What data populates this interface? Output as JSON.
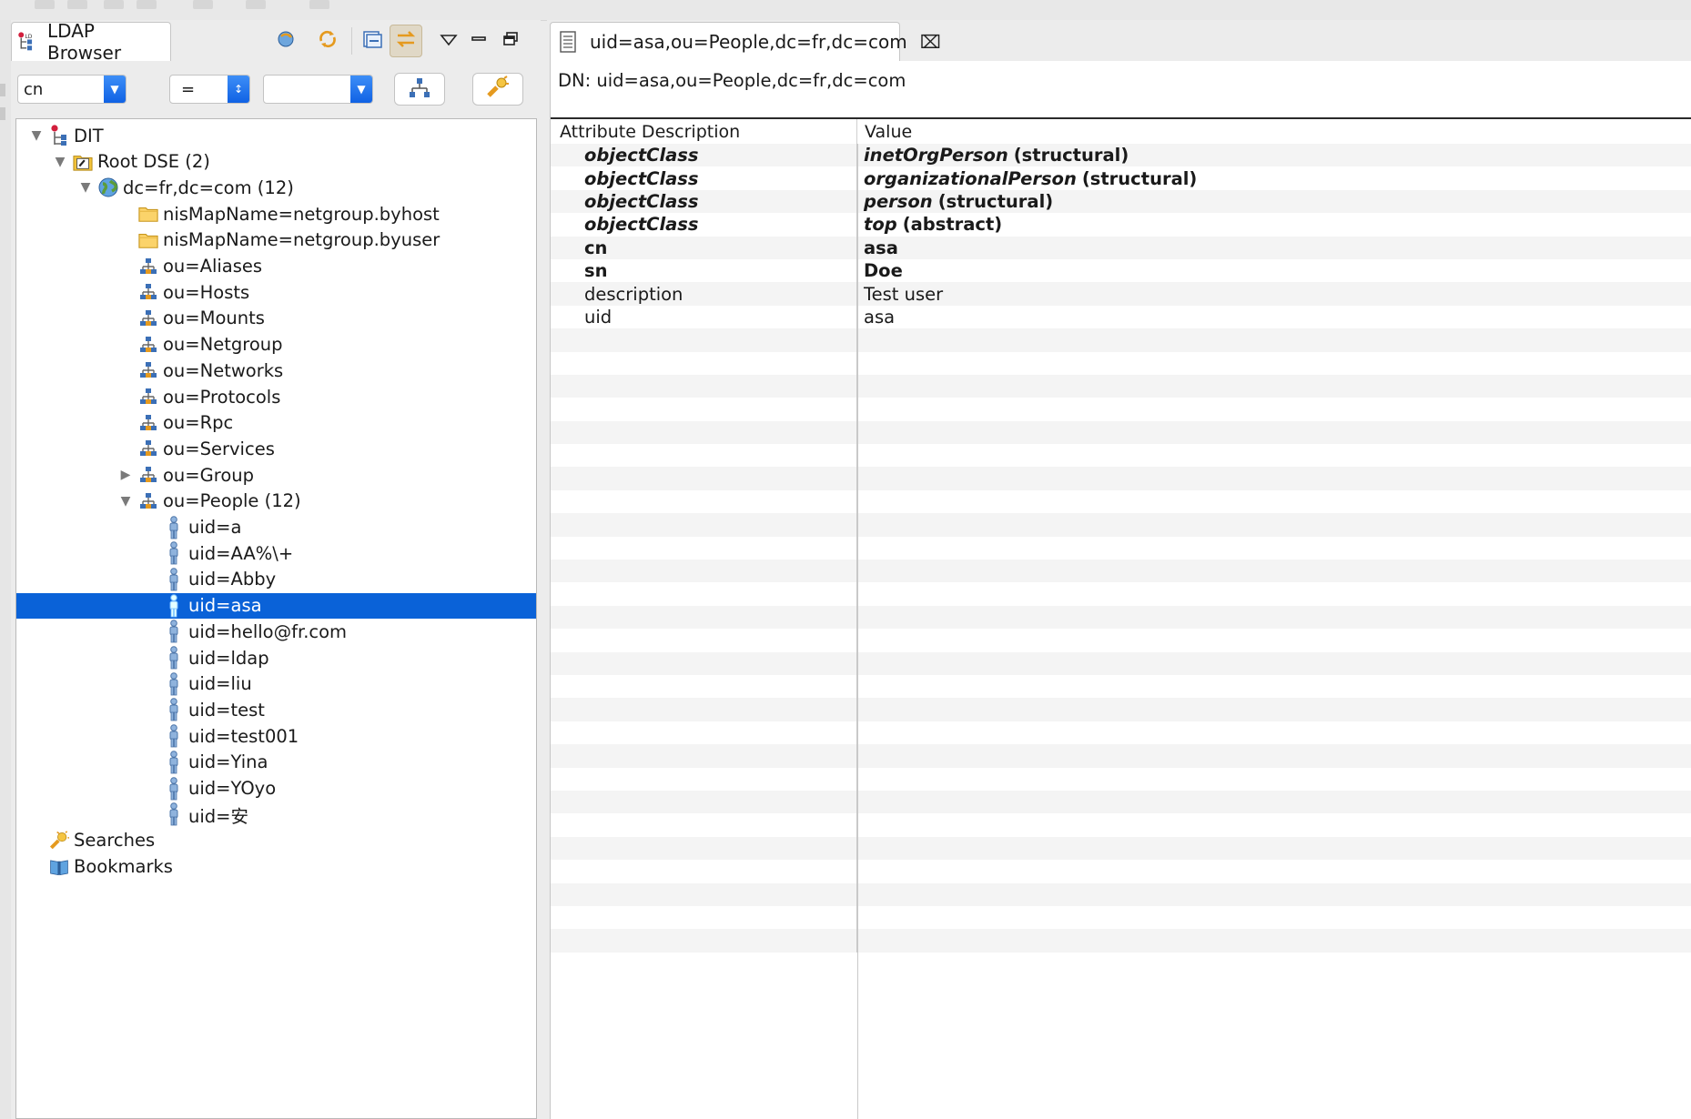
{
  "browser": {
    "tab_label": "LDAP Browser",
    "filter": {
      "attribute": "cn",
      "operator": "=",
      "value": ""
    }
  },
  "tree": [
    {
      "label": "DIT",
      "level": 0,
      "twisty": "open",
      "icon": "dit-icon"
    },
    {
      "label": "Root DSE (2)",
      "level": 1,
      "twisty": "open",
      "icon": "root-dse-icon"
    },
    {
      "label": "dc=fr,dc=com (12)",
      "level": 2,
      "twisty": "open",
      "icon": "globe-icon"
    },
    {
      "label": "nisMapName=netgroup.byhost",
      "level": 3,
      "twisty": "none",
      "icon": "folder-icon"
    },
    {
      "label": "nisMapName=netgroup.byuser",
      "level": 3,
      "twisty": "none",
      "icon": "folder-icon"
    },
    {
      "label": "ou=Aliases",
      "level": 3,
      "twisty": "none",
      "icon": "org-unit-icon"
    },
    {
      "label": "ou=Hosts",
      "level": 3,
      "twisty": "none",
      "icon": "org-unit-icon"
    },
    {
      "label": "ou=Mounts",
      "level": 3,
      "twisty": "none",
      "icon": "org-unit-icon"
    },
    {
      "label": "ou=Netgroup",
      "level": 3,
      "twisty": "none",
      "icon": "org-unit-icon"
    },
    {
      "label": "ou=Networks",
      "level": 3,
      "twisty": "none",
      "icon": "org-unit-icon"
    },
    {
      "label": "ou=Protocols",
      "level": 3,
      "twisty": "none",
      "icon": "org-unit-icon"
    },
    {
      "label": "ou=Rpc",
      "level": 3,
      "twisty": "none",
      "icon": "org-unit-icon"
    },
    {
      "label": "ou=Services",
      "level": 3,
      "twisty": "none",
      "icon": "org-unit-icon"
    },
    {
      "label": "ou=Group",
      "level": 3,
      "twisty": "closed",
      "icon": "org-unit-icon"
    },
    {
      "label": "ou=People (12)",
      "level": 3,
      "twisty": "open",
      "icon": "org-unit-icon"
    },
    {
      "label": "uid=a",
      "level": 4,
      "twisty": "none",
      "icon": "person-icon"
    },
    {
      "label": "uid=AA%\\+",
      "level": 4,
      "twisty": "none",
      "icon": "person-icon"
    },
    {
      "label": "uid=Abby",
      "level": 4,
      "twisty": "none",
      "icon": "person-icon"
    },
    {
      "label": "uid=asa",
      "level": 4,
      "twisty": "none",
      "icon": "person-icon",
      "selected": true
    },
    {
      "label": "uid=hello@fr.com",
      "level": 4,
      "twisty": "none",
      "icon": "person-icon"
    },
    {
      "label": "uid=ldap",
      "level": 4,
      "twisty": "none",
      "icon": "person-icon"
    },
    {
      "label": "uid=liu",
      "level": 4,
      "twisty": "none",
      "icon": "person-icon"
    },
    {
      "label": "uid=test",
      "level": 4,
      "twisty": "none",
      "icon": "person-icon"
    },
    {
      "label": "uid=test001",
      "level": 4,
      "twisty": "none",
      "icon": "person-icon"
    },
    {
      "label": "uid=Yina",
      "level": 4,
      "twisty": "none",
      "icon": "person-icon"
    },
    {
      "label": "uid=YOyo",
      "level": 4,
      "twisty": "none",
      "icon": "person-icon"
    },
    {
      "label": "uid=安",
      "level": 4,
      "twisty": "none",
      "icon": "person-icon"
    },
    {
      "label": "Searches",
      "level": 0,
      "twisty": "none",
      "icon": "searches-icon"
    },
    {
      "label": "Bookmarks",
      "level": 0,
      "twisty": "none",
      "icon": "bookmarks-icon"
    }
  ],
  "editor": {
    "tab_label": "uid=asa,ou=People,dc=fr,dc=com",
    "dn_line": "DN: uid=asa,ou=People,dc=fr,dc=com",
    "columns": [
      "Attribute Description",
      "Value"
    ],
    "attributes": [
      {
        "name": "objectClass",
        "value": "inetOrgPerson",
        "qualifier": "(structural)",
        "style": "objectclass"
      },
      {
        "name": "objectClass",
        "value": "organizationalPerson",
        "qualifier": "(structural)",
        "style": "objectclass"
      },
      {
        "name": "objectClass",
        "value": "person",
        "qualifier": "(structural)",
        "style": "objectclass"
      },
      {
        "name": "objectClass",
        "value": "top",
        "qualifier": "(abstract)",
        "style": "objectclass"
      },
      {
        "name": "cn",
        "value": "asa",
        "qualifier": "",
        "style": "must"
      },
      {
        "name": "sn",
        "value": "Doe",
        "qualifier": "",
        "style": "must"
      },
      {
        "name": "description",
        "value": "Test user",
        "qualifier": "",
        "style": "may"
      },
      {
        "name": "uid",
        "value": "asa",
        "qualifier": "",
        "style": "may"
      }
    ],
    "empty_rows": 27
  },
  "colors": {
    "selection": "#0a62d8",
    "accent": "#1062e4"
  }
}
